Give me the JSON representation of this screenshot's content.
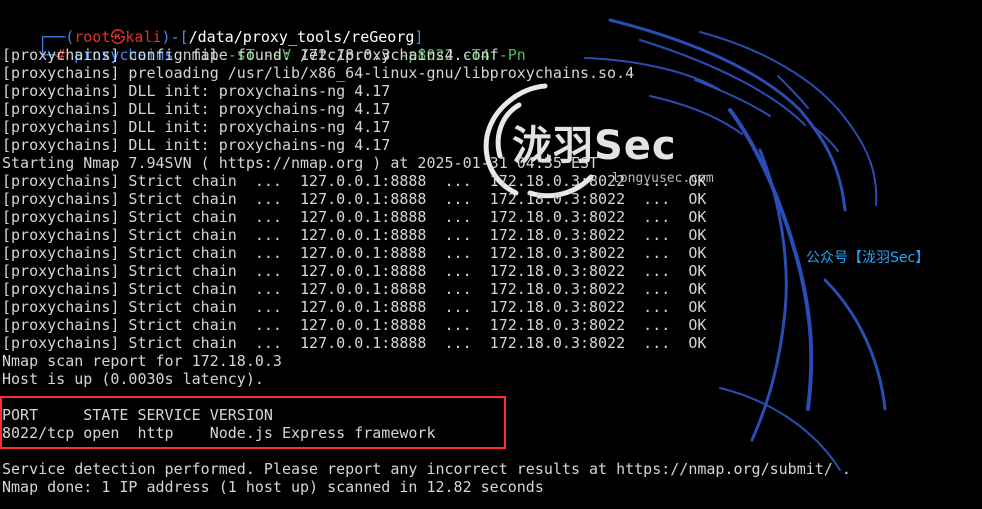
{
  "prompt": {
    "user": "root",
    "at_symbol": "㉿",
    "host": "kali",
    "path": "/data/proxy_tools/reGeorg",
    "symbol": "#",
    "command": {
      "tool": "proxychains",
      "program": "nmap",
      "flag_sT": "-sT",
      "flag_sV": "-sV",
      "target": "172.18.0.3",
      "flag_p": "-p8022",
      "flag_T": "-T4",
      "flag_Pn": "-Pn"
    }
  },
  "output": {
    "config": "[proxychains] config file found: /etc/proxychains4.conf",
    "preload": "[proxychains] preloading /usr/lib/x86_64-linux-gnu/libproxychains.so.4",
    "dll1": "[proxychains] DLL init: proxychains-ng 4.17",
    "dll2": "[proxychains] DLL init: proxychains-ng 4.17",
    "dll3": "[proxychains] DLL init: proxychains-ng 4.17",
    "dll4": "[proxychains] DLL init: proxychains-ng 4.17",
    "starting": "Starting Nmap 7.94SVN ( https://nmap.org ) at 2025-01-31 04:35 EST",
    "chain1": "[proxychains] Strict chain  ...  127.0.0.1:8888  ...  172.18.0.3:8022  ...  OK",
    "chain2": "[proxychains] Strict chain  ...  127.0.0.1:8888  ...  172.18.0.3:8022  ...  OK",
    "chain3": "[proxychains] Strict chain  ...  127.0.0.1:8888  ...  172.18.0.3:8022  ...  OK",
    "chain4": "[proxychains] Strict chain  ...  127.0.0.1:8888  ...  172.18.0.3:8022  ...  OK",
    "chain5": "[proxychains] Strict chain  ...  127.0.0.1:8888  ...  172.18.0.3:8022  ...  OK",
    "chain6": "[proxychains] Strict chain  ...  127.0.0.1:8888  ...  172.18.0.3:8022  ...  OK",
    "chain7": "[proxychains] Strict chain  ...  127.0.0.1:8888  ...  172.18.0.3:8022  ...  OK",
    "chain8": "[proxychains] Strict chain  ...  127.0.0.1:8888  ...  172.18.0.3:8022  ...  OK",
    "chain9": "[proxychains] Strict chain  ...  127.0.0.1:8888  ...  172.18.0.3:8022  ...  OK",
    "chain10": "[proxychains] Strict chain  ...  127.0.0.1:8888  ...  172.18.0.3:8022  ...  OK",
    "report": "Nmap scan report for 172.18.0.3",
    "host_up": "Host is up (0.0030s latency).",
    "port_header": "PORT     STATE SERVICE VERSION",
    "port_row": "8022/tcp open  http    Node.js Express framework",
    "service_detection": "Service detection performed. Please report any incorrect results at https://nmap.org/submit/ .",
    "done": "Nmap done: 1 IP address (1 host up) scanned in 12.82 seconds"
  },
  "watermark": {
    "brand": "泷羽Sec",
    "url": "longyusec.com",
    "wechat": "公众号【泷羽Sec】"
  },
  "colors": {
    "background": "#000000",
    "prompt_blue": "#3f8cff",
    "prompt_red": "#e0302b",
    "flag_green": "#4ebd5a",
    "text": "#d3d7cf",
    "highlight_red": "#ff2d2d",
    "wechat_blue": "#1ea7ff"
  }
}
